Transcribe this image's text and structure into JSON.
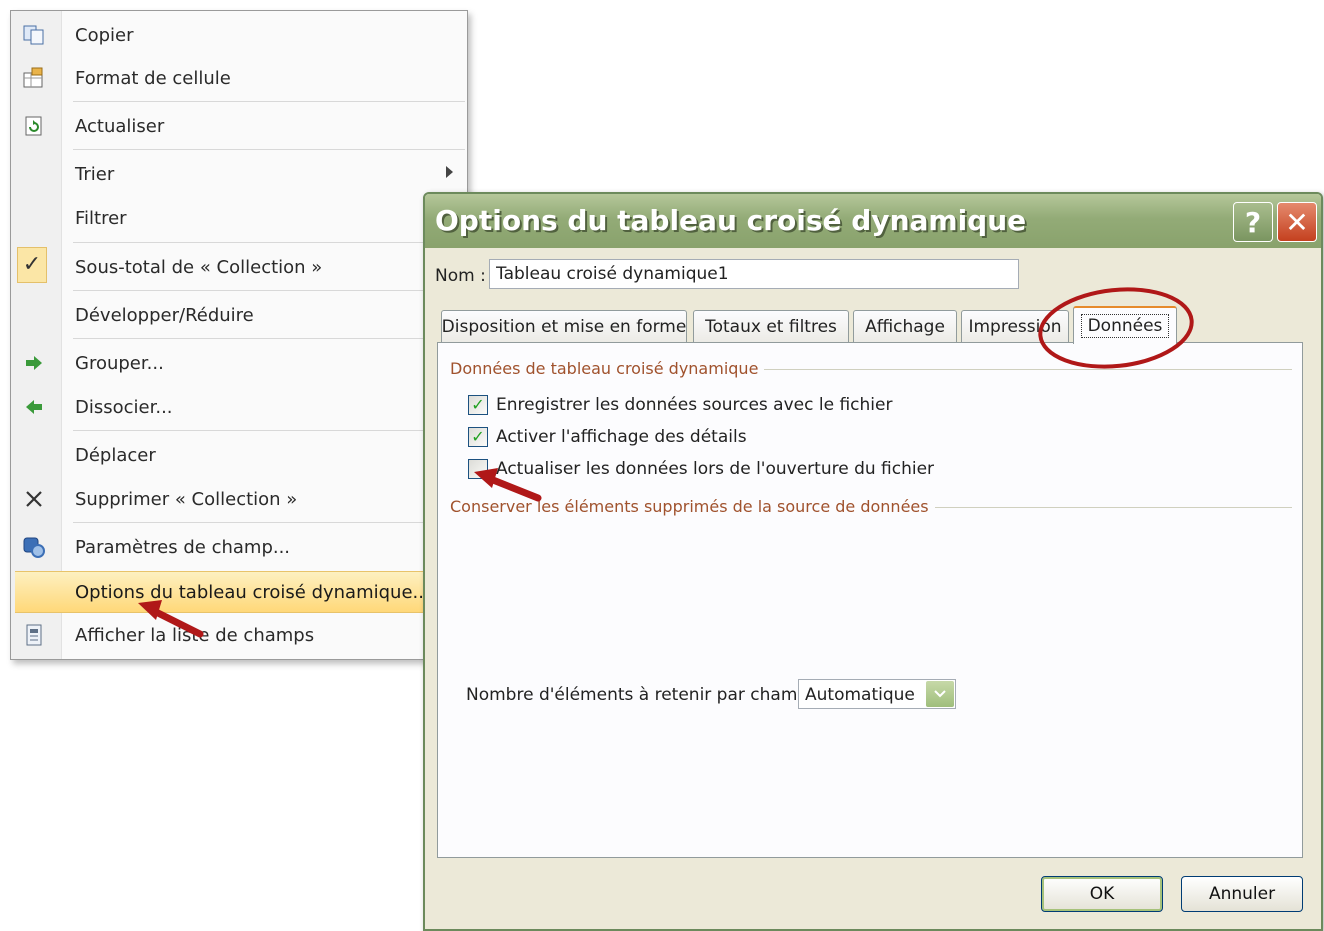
{
  "context_menu": {
    "items": [
      {
        "label": "Copier",
        "icon": "copy-icon"
      },
      {
        "label": "Format de cellule",
        "icon": "format-cells-icon"
      },
      {
        "label": "Actualiser",
        "icon": "refresh-icon"
      },
      {
        "label": "Trier",
        "icon": "",
        "submenu": true
      },
      {
        "label": "Filtrer",
        "icon": ""
      },
      {
        "label": "Sous-total de « Collection »",
        "icon": "checkmark-icon",
        "checked": true
      },
      {
        "label": "Développer/Réduire",
        "icon": ""
      },
      {
        "label": "Grouper...",
        "icon": "group-arrow-icon"
      },
      {
        "label": "Dissocier...",
        "icon": "ungroup-arrow-icon"
      },
      {
        "label": "Déplacer",
        "icon": ""
      },
      {
        "label": "Supprimer « Collection »",
        "icon": "delete-x-icon"
      },
      {
        "label": "Paramètres de champ...",
        "icon": "field-settings-icon"
      },
      {
        "label": "Options du tableau croisé dynamique...",
        "icon": "",
        "highlighted": true
      },
      {
        "label": "Afficher la liste de champs",
        "icon": "field-list-icon"
      }
    ]
  },
  "dialog": {
    "title": "Options du tableau croisé dynamique",
    "help_label": "?",
    "close_label": "✕",
    "name_label": "Nom :",
    "name_value": "Tableau croisé dynamique1",
    "tabs": [
      {
        "label": "Disposition et mise en forme"
      },
      {
        "label": "Totaux et filtres"
      },
      {
        "label": "Affichage"
      },
      {
        "label": "Impression"
      },
      {
        "label": "Données",
        "active": true
      }
    ],
    "group1_title": "Données de tableau croisé dynamique",
    "checkboxes": [
      {
        "label": "Enregistrer les données sources avec le fichier",
        "checked": true
      },
      {
        "label": "Activer l'affichage des détails",
        "checked": true
      },
      {
        "label": "Actualiser les données lors de l'ouverture du fichier",
        "checked": false
      }
    ],
    "group2_title": "Conserver les éléments supprimés de la source de données",
    "retain_label": "Nombre d'éléments à retenir par champ :",
    "retain_value": "Automatique",
    "ok_label": "OK",
    "cancel_label": "Annuler"
  },
  "colors": {
    "titlebar": "#93ab77",
    "menu_highlight": "#ffd879",
    "annotation_red": "#b01818",
    "group_title": "#a0522d"
  }
}
